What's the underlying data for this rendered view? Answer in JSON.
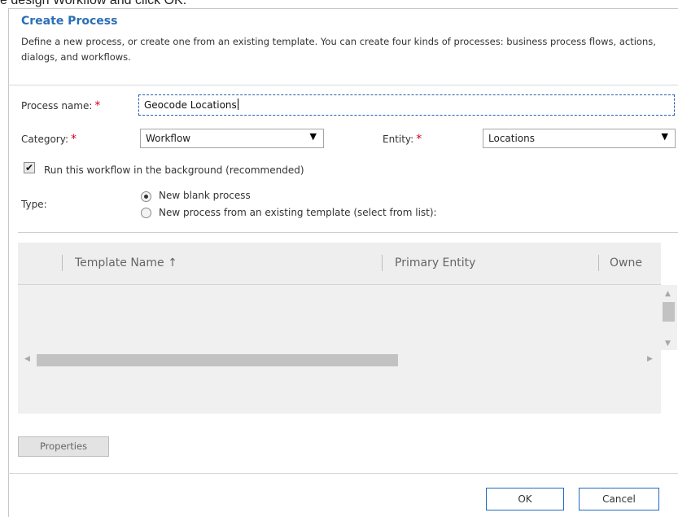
{
  "caption": "e design Workflow and click OK.",
  "dialog": {
    "title": "Create Process",
    "description": "Define a new process, or create one from an existing template. You can create four kinds of processes: business process flows, actions, dialogs, and workflows."
  },
  "form": {
    "process_name_label": "Process name:",
    "process_name_value": "Geocode Locations",
    "category_label": "Category:",
    "category_value": "Workflow",
    "entity_label": "Entity:",
    "entity_value": "Locations",
    "required_marker": "*",
    "background_checkbox_label": "Run this workflow in the background (recommended)",
    "background_checked": true,
    "type_label": "Type:",
    "type_options": [
      "New blank process",
      "New process from an existing template (select from list):"
    ],
    "type_selected": "New blank process"
  },
  "grid": {
    "columns": [
      "Template Name ↑",
      "Primary Entity",
      "Owne"
    ]
  },
  "buttons": {
    "properties": "Properties",
    "ok": "OK",
    "cancel": "Cancel"
  },
  "colors": {
    "title": "#2b6fb6",
    "required": "#d0021b",
    "button_border": "#1f6bbf"
  }
}
